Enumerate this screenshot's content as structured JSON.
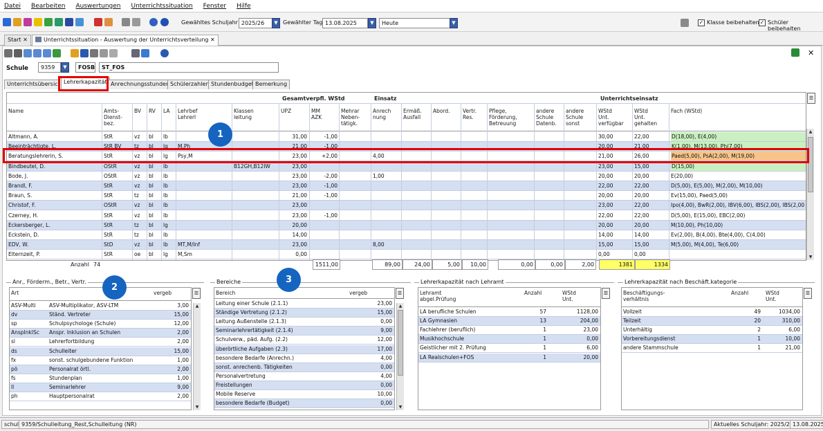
{
  "menu": [
    "Datei",
    "Bearbeiten",
    "Auswertungen",
    "Unterrichtssituation",
    "Fenster",
    "Hilfe"
  ],
  "toolbar": {
    "schuljahr_label": "Gewähltes Schuljahr",
    "schuljahr_value": "2025/26",
    "tag_label": "Gewählter Tag",
    "tag_value": "13.08.2025",
    "heute_value": "Heute",
    "klasse_label": "Klasse beibehalten",
    "schueler_label": "Schüler beibehalten"
  },
  "window_tabs": [
    "Start",
    "Unterrichtssituation - Auswertung der Unterrichtsverteilung"
  ],
  "schule": {
    "label": "Schule",
    "nummer": "9359",
    "kuerzel": "FOSB",
    "name": "ST_FOS"
  },
  "sub_tabs": [
    "Unterrichtsübersicht",
    "Lehrerkapazität",
    "Anrechnungsstunden",
    "Schülerzahlen",
    "Stundenbudget",
    "Bemerkung"
  ],
  "group_headers": {
    "gesamt": "Gesamtverpfl. WStd",
    "einsatz": "Einsatz",
    "unterricht": "Unterrichtseinsatz"
  },
  "columns": {
    "name": "Name",
    "amts": "Amts-\nDienst-\nbez.",
    "bv": "BV",
    "rv": "RV",
    "la": "LA",
    "lehrbef": "Lehrbef\nLehrerl",
    "klassen": "Klassen\nleitung",
    "upz": "UPZ",
    "mm": "MM\nAZK",
    "mehrar": "Mehrar\nNeben-\ntätigk.",
    "anrech": "Anrech\nnung",
    "ermaess": "Ermäß.\nAusfall",
    "abord": "Abord.",
    "vertr": "Vertr.\nRes.",
    "pflege": "Pflege,\nFörderung,\nBetreuung",
    "andere_datenb": "andere\nSchule\nDatenb.",
    "andere_sonst": "andere\nSchule\nsonst",
    "wstd_verf": "WStd\nUnt.\nverfügbar",
    "wstd_geh": "WStd\nUnt.\ngehalten",
    "fach": "Fach (WStd)"
  },
  "rows": [
    {
      "name": "Altmann, A.",
      "amts": "StR",
      "bv": "vz",
      "rv": "bl",
      "la": "lb",
      "lehrbef": "",
      "klassen": "",
      "upz": "31,00",
      "mm": "-1,00",
      "anrech": "",
      "ermaess": "",
      "abord": "",
      "vertr": "",
      "pflege": "",
      "andere_datenb": "",
      "andere_sonst": "",
      "verf": "30,00",
      "geh": "22,00",
      "fach": "D(18,00), E(4,00)",
      "hl": "green"
    },
    {
      "name": "Beeinträchtigte, L.",
      "amts": "StR BV",
      "bv": "tz",
      "rv": "bl",
      "la": "lg",
      "lehrbef": "M,Ph",
      "klassen": "",
      "upz": "21,00",
      "mm": "-1,00",
      "anrech": "",
      "ermaess": "",
      "abord": "",
      "vertr": "",
      "pflege": "",
      "andere_datenb": "",
      "andere_sonst": "",
      "verf": "20,00",
      "geh": "21,00",
      "fach": "K(1,00), M(13,00), Ph(7,00)",
      "hl": "green"
    },
    {
      "name": "Beratungslehrerin, S.",
      "amts": "StR",
      "bv": "vz",
      "rv": "bl",
      "la": "lg",
      "lehrbef": "Psy,M",
      "klassen": "",
      "upz": "23,00",
      "mm": "+2,00",
      "anrech": "4,00",
      "ermaess": "",
      "abord": "",
      "vertr": "",
      "pflege": "",
      "andere_datenb": "",
      "andere_sonst": "",
      "verf": "21,00",
      "geh": "26,00",
      "fach": "Paed(5,00), PsA(2,00), M(19,00)",
      "hl": "orange"
    },
    {
      "name": "Bindbeutel, D.",
      "amts": "OStR",
      "bv": "vz",
      "rv": "bl",
      "la": "lb",
      "lehrbef": "",
      "klassen": "B12GH,B12IW",
      "upz": "23,00",
      "mm": "",
      "anrech": "",
      "ermaess": "",
      "abord": "",
      "vertr": "",
      "pflege": "",
      "andere_datenb": "",
      "andere_sonst": "",
      "verf": "23,00",
      "geh": "15,00",
      "fach": "D(15,00)",
      "hl": "green"
    },
    {
      "name": "Bode, J.",
      "amts": "OStR",
      "bv": "vz",
      "rv": "bl",
      "la": "lb",
      "lehrbef": "",
      "klassen": "",
      "upz": "23,00",
      "mm": "-2,00",
      "anrech": "1,00",
      "ermaess": "",
      "abord": "",
      "vertr": "",
      "pflege": "",
      "andere_datenb": "",
      "andere_sonst": "",
      "verf": "20,00",
      "geh": "20,00",
      "fach": "E(20,00)",
      "hl": ""
    },
    {
      "name": "Brandl, F.",
      "amts": "StR",
      "bv": "vz",
      "rv": "bl",
      "la": "lb",
      "lehrbef": "",
      "klassen": "",
      "upz": "23,00",
      "mm": "-1,00",
      "anrech": "",
      "ermaess": "",
      "abord": "",
      "vertr": "",
      "pflege": "",
      "andere_datenb": "",
      "andere_sonst": "",
      "verf": "22,00",
      "geh": "22,00",
      "fach": "D(5,00), E(5,00), M(2,00), M(10,00)",
      "hl": ""
    },
    {
      "name": "Braun, S.",
      "amts": "StR",
      "bv": "tz",
      "rv": "bl",
      "la": "lb",
      "lehrbef": "",
      "klassen": "",
      "upz": "21,00",
      "mm": "-1,00",
      "anrech": "",
      "ermaess": "",
      "abord": "",
      "vertr": "",
      "pflege": "",
      "andere_datenb": "",
      "andere_sonst": "",
      "verf": "20,00",
      "geh": "20,00",
      "fach": "Ev(15,00), Paed(5,00)",
      "hl": ""
    },
    {
      "name": "Christof, F.",
      "amts": "OStR",
      "bv": "vz",
      "rv": "bl",
      "la": "lb",
      "lehrbef": "",
      "klassen": "",
      "upz": "23,00",
      "mm": "",
      "anrech": "",
      "ermaess": "",
      "abord": "",
      "vertr": "",
      "pflege": "",
      "andere_datenb": "",
      "andere_sonst": "",
      "verf": "23,00",
      "geh": "22,00",
      "fach": "Ipo(4,00), BwR(2,00), IBV(6,00), IBS(2,00), IBS(2,00),",
      "hl": ""
    },
    {
      "name": "Czerney, H.",
      "amts": "StR",
      "bv": "vz",
      "rv": "bl",
      "la": "lb",
      "lehrbef": "",
      "klassen": "",
      "upz": "23,00",
      "mm": "-1,00",
      "anrech": "",
      "ermaess": "",
      "abord": "",
      "vertr": "",
      "pflege": "",
      "andere_datenb": "",
      "andere_sonst": "",
      "verf": "22,00",
      "geh": "22,00",
      "fach": "D(5,00), E(15,00), EBC(2,00)",
      "hl": ""
    },
    {
      "name": "Eckersberger, L.",
      "amts": "StR",
      "bv": "tz",
      "rv": "bl",
      "la": "lg",
      "lehrbef": "",
      "klassen": "",
      "upz": "20,00",
      "mm": "",
      "anrech": "",
      "ermaess": "",
      "abord": "",
      "vertr": "",
      "pflege": "",
      "andere_datenb": "",
      "andere_sonst": "",
      "verf": "20,00",
      "geh": "20,00",
      "fach": "M(10,00), Ph(10,00)",
      "hl": ""
    },
    {
      "name": "Eckstein, D.",
      "amts": "StR",
      "bv": "tz",
      "rv": "bl",
      "la": "lb",
      "lehrbef": "",
      "klassen": "",
      "upz": "14,00",
      "mm": "",
      "anrech": "",
      "ermaess": "",
      "abord": "",
      "vertr": "",
      "pflege": "",
      "andere_datenb": "",
      "andere_sonst": "",
      "verf": "14,00",
      "geh": "14,00",
      "fach": "Ev(2,00), B(4,00), Bte(4,00), C(4,00)",
      "hl": ""
    },
    {
      "name": "EDV, W.",
      "amts": "StD",
      "bv": "vz",
      "rv": "bl",
      "la": "lb",
      "lehrbef": "MT,M/Inf",
      "klassen": "",
      "upz": "23,00",
      "mm": "",
      "anrech": "8,00",
      "ermaess": "",
      "abord": "",
      "vertr": "",
      "pflege": "",
      "andere_datenb": "",
      "andere_sonst": "",
      "verf": "15,00",
      "geh": "15,00",
      "fach": "M(5,00), M(4,00), Te(6,00)",
      "hl": ""
    },
    {
      "name": "Elternzeit, P.",
      "amts": "StR",
      "bv": "oe",
      "rv": "bl",
      "la": "lg",
      "lehrbef": "M,Sm",
      "klassen": "",
      "upz": "0,00",
      "mm": "",
      "anrech": "",
      "ermaess": "",
      "abord": "",
      "vertr": "",
      "pflege": "",
      "andere_datenb": "",
      "andere_sonst": "",
      "verf": "0,00",
      "geh": "0,00",
      "fach": "",
      "hl": ""
    }
  ],
  "summary": {
    "anzahl_label": "Anzahl",
    "anzahl": "74",
    "upz": "1511,00",
    "anrech": "89,00",
    "ermaess": "24,00",
    "abord": "5,00",
    "vertr": "10,00",
    "pflege": "0,00",
    "andere_datenb": "0,00",
    "andere_sonst": "2,00",
    "verf": "1381",
    "geh": "1334"
  },
  "anr_section": {
    "title": "Anr., Förderm., Betr., Vertr.",
    "headers": {
      "art": "Art",
      "vergeb": "vergeb"
    },
    "rows": [
      {
        "art": "ASV-Multi",
        "desc": "ASV-Multiplikator, ASV-LTM",
        "val": "3,00"
      },
      {
        "art": "dv",
        "desc": "Ständ. Vertreter",
        "val": "15,00"
      },
      {
        "art": "sp",
        "desc": "Schulpsychologe (Schule)",
        "val": "12,00"
      },
      {
        "art": "AnspInklSc",
        "desc": "Anspr. Inklusion an Schulen",
        "val": "2,00"
      },
      {
        "art": "sl",
        "desc": "Lehrerfortbildung",
        "val": "2,00"
      },
      {
        "art": "ds",
        "desc": "Schulleiter",
        "val": "15,00"
      },
      {
        "art": "fx",
        "desc": "sonst. schulgebundene Funktion",
        "val": "1,00"
      },
      {
        "art": "pö",
        "desc": "Personalrat örtl.",
        "val": "2,00"
      },
      {
        "art": "fs",
        "desc": "Stundenplan",
        "val": "1,00"
      },
      {
        "art": "ll",
        "desc": "Seminarlehrer",
        "val": "9,00"
      },
      {
        "art": "ph",
        "desc": "Hauptpersonalrat",
        "val": "2,00"
      }
    ]
  },
  "bereiche_section": {
    "title": "Bereiche",
    "headers": {
      "bereich": "Bereich",
      "vergeb": "vergeb"
    },
    "rows": [
      {
        "b": "Leitung einer Schule (2.1.1)",
        "v": "23,00"
      },
      {
        "b": "Ständige Vertretung (2.1.2)",
        "v": "15,00"
      },
      {
        "b": "Leitung Außenstelle (2.1.3)",
        "v": "0,00"
      },
      {
        "b": "Seminarlehrertätigkeit (2.1.4)",
        "v": "9,00"
      },
      {
        "b": "Schulverw., päd. Aufg. (2.2)",
        "v": "12,00"
      },
      {
        "b": "überörtliche Aufgaben (2.3)",
        "v": "17,00"
      },
      {
        "b": "besondere Bedarfe (Anrechn.)",
        "v": "4,00"
      },
      {
        "b": "sonst. anrechenb. Tätigkeiten",
        "v": "0,00"
      },
      {
        "b": "Personalvertretung",
        "v": "4,00"
      },
      {
        "b": "Freistellungen",
        "v": "0,00"
      },
      {
        "b": "Mobile Reserve",
        "v": "10,00"
      },
      {
        "b": "besondere Bedarfe (Budget)",
        "v": "0,00"
      }
    ]
  },
  "lehramt_section": {
    "title": "Lehrerkapazität nach Lehramt",
    "headers": {
      "lehramt": "Lehramt\nabgel.Prüfung",
      "anzahl": "Anzahl",
      "wstd": "WStd\nUnt."
    },
    "rows": [
      {
        "l": "LA berufliche Schulen",
        "a": "57",
        "w": "1128,00"
      },
      {
        "l": "LA Gymnasien",
        "a": "13",
        "w": "204,00"
      },
      {
        "l": "Fachlehrer (beruflich)",
        "a": "1",
        "w": "23,00"
      },
      {
        "l": "Musikhochschule",
        "a": "1",
        "w": "0,00"
      },
      {
        "l": "Geistlicher mit 2. Prüfung",
        "a": "1",
        "w": "6,00"
      },
      {
        "l": "LA Realschulen+FOS",
        "a": "1",
        "w": "20,00"
      }
    ]
  },
  "beschaeft_section": {
    "title": "Lehrerkapazität nach Beschäft.kategorie",
    "headers": {
      "kat": "Beschäftigungs-\nverhältnis",
      "anzahl": "Anzahl",
      "wstd": "WStd\nUnt."
    },
    "rows": [
      {
        "k": "Vollzeit",
        "a": "49",
        "w": "1034,00"
      },
      {
        "k": "Teilzeit",
        "a": "20",
        "w": "310,00"
      },
      {
        "k": "Unterhältig",
        "a": "2",
        "w": "6,00"
      },
      {
        "k": "Vorbereitungsdienst",
        "a": "1",
        "w": "10,00"
      },
      {
        "k": "andere Stammschule",
        "a": "1",
        "w": "21,00"
      }
    ]
  },
  "badges": [
    "1",
    "2",
    "3"
  ],
  "statusbar": {
    "left": "schul",
    "center": "9359/Schulleitung_Rest,Schulleitung (NR)",
    "right1": "Aktuelles Schuljahr: 2025/26",
    "right2": "13.08.2025"
  },
  "colors": {
    "green": "#c8f0c0",
    "orange": "#f6c48a",
    "yellow": "#ffff66",
    "rowblue": "#d5dff2",
    "badge": "#1565c0",
    "red": "#e00000"
  }
}
